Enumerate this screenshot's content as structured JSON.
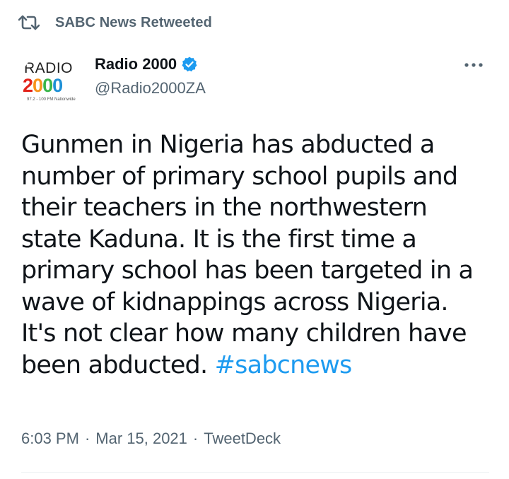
{
  "retweet_banner": {
    "icon": "retweet-icon",
    "text": "SABC News Retweeted"
  },
  "author": {
    "display_name": "Radio 2000",
    "handle": "@Radio2000ZA",
    "verified_icon": "verified-badge-icon",
    "avatar_logo": {
      "line1": "RADIO",
      "line2": "2000",
      "line3": "97.2 - 100 FM Nationwide"
    }
  },
  "more_icon": "more-options-icon",
  "tweet": {
    "body": "Gunmen in Nigeria has abducted a number of primary school pupils and their teachers in the northwestern state Kaduna. It is the first time a primary school has been targeted in a wave of kidnappings across Nigeria. It's not clear how many children have been abducted. ",
    "hashtag": "#sabcnews"
  },
  "meta": {
    "time": "6:03 PM",
    "separator": "·",
    "date": "Mar 15, 2021",
    "source": "TweetDeck"
  },
  "colors": {
    "text": "#0f1419",
    "secondary": "#536471",
    "link": "#1d9bf0",
    "verified": "#1d9bf0"
  }
}
